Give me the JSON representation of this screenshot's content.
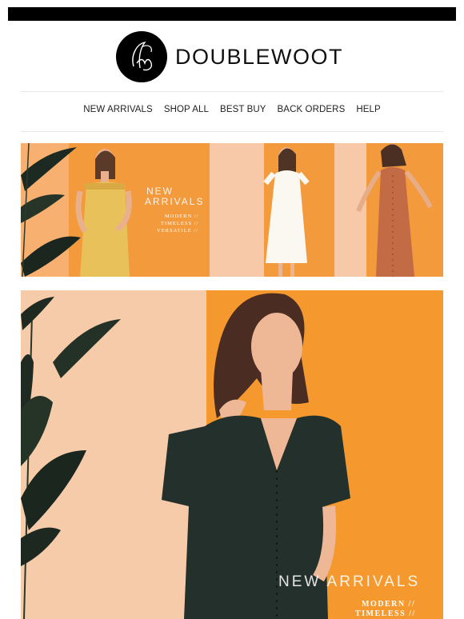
{
  "brand": {
    "name": "DOUBLEWOOT",
    "logo_glyph": "dw"
  },
  "nav": {
    "items": [
      {
        "label": "NEW ARRIVALS"
      },
      {
        "label": "SHOP ALL"
      },
      {
        "label": "BEST BUY"
      },
      {
        "label": "BACK ORDERS"
      },
      {
        "label": "HELP"
      }
    ]
  },
  "banner": {
    "headline_1": "NEW",
    "headline_2": "ARRIVALS",
    "tag_1": "MODERN //",
    "tag_2": "TIMELESS //",
    "tag_3": "VERSATILE //"
  },
  "hero": {
    "headline": "NEW ARRIVALS",
    "tag_1": "MODERN //",
    "tag_2": "TIMELESS //"
  },
  "colors": {
    "accent_orange": "#f39a3c",
    "peach": "#f6c7a3",
    "dress_yellow": "#e9c15a",
    "dress_rust": "#c26b45",
    "dress_dark": "#24302b"
  }
}
